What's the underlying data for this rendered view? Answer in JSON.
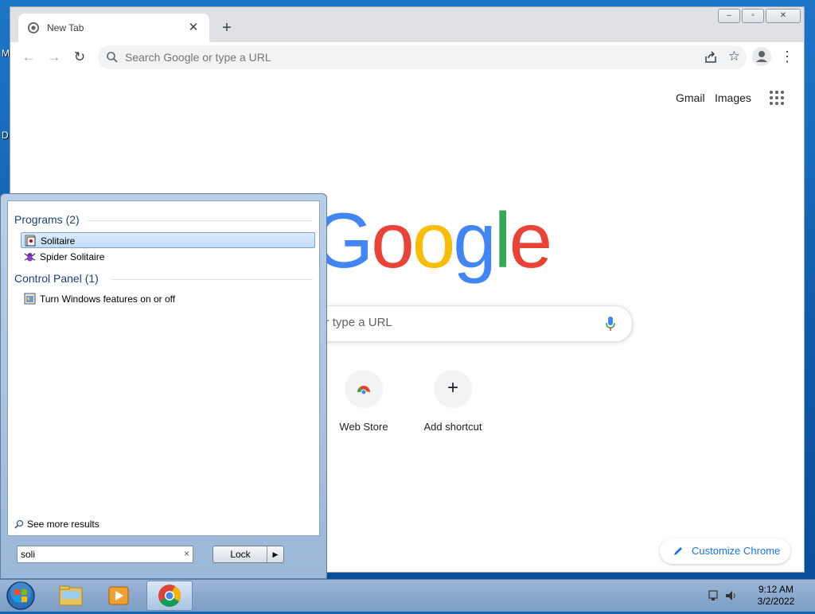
{
  "desktop": {
    "edge_chars": [
      "M",
      "D"
    ]
  },
  "browser": {
    "tab": {
      "title": "New Tab"
    },
    "window_controls": {
      "minimize": "–",
      "restore": "▫",
      "close": "✕"
    },
    "nav": {
      "back": "←",
      "forward": "→",
      "reload": "↻"
    },
    "omnibox": {
      "placeholder": "Search Google or type a URL",
      "star": "☆"
    },
    "menu": "⋮",
    "new_tab": "+"
  },
  "ntp": {
    "links": {
      "gmail": "Gmail",
      "images": "Images"
    },
    "logo_letters": [
      {
        "ch": "G",
        "color": "#4285f4"
      },
      {
        "ch": "o",
        "color": "#ea4335"
      },
      {
        "ch": "o",
        "color": "#fbbc05"
      },
      {
        "ch": "g",
        "color": "#4285f4"
      },
      {
        "ch": "l",
        "color": "#34a853"
      },
      {
        "ch": "e",
        "color": "#ea4335"
      }
    ],
    "search_placeholder": "Search Google or type a URL",
    "shortcuts": [
      {
        "label": "Web Store"
      },
      {
        "label": "Add shortcut",
        "glyph": "+"
      }
    ],
    "customize_label": "Customize Chrome"
  },
  "start_menu": {
    "programs_header": "Programs (2)",
    "programs": [
      {
        "label": "Solitaire",
        "selected": true
      },
      {
        "label": "Spider Solitaire",
        "selected": false
      }
    ],
    "control_panel_header": "Control Panel (1)",
    "control_panel": [
      {
        "label": "Turn Windows features on or off"
      }
    ],
    "see_more": "See more results",
    "search_value": "soli",
    "clear": "×",
    "lock_label": "Lock",
    "lock_arrow": "▶"
  },
  "taskbar": {
    "time": "9:12 AM",
    "date": "3/2/2022"
  },
  "colors": {
    "accent_blue": "#1a73e8",
    "start_header": "#1e3f7a",
    "desktop": "#1565b6"
  }
}
